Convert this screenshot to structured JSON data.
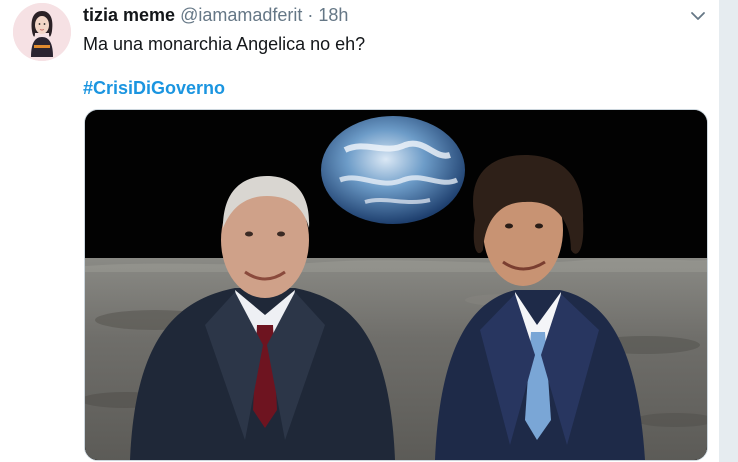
{
  "tweet": {
    "display_name": "tizia meme",
    "handle": "@iamamadferit",
    "separator": "·",
    "time": "18h",
    "text": "Ma una monarchia Angelica no eh?",
    "hashtag": "#CrisiDiGoverno",
    "avatar_icon": "illustrated-woman-avatar",
    "menu_icon": "chevron-down-icon",
    "media_description_icon": "photo-two-men-on-moon-with-earth"
  },
  "colors": {
    "text": "#14171a",
    "secondary": "#657786",
    "link": "#1b95e0",
    "background": "#e6ecf0"
  }
}
